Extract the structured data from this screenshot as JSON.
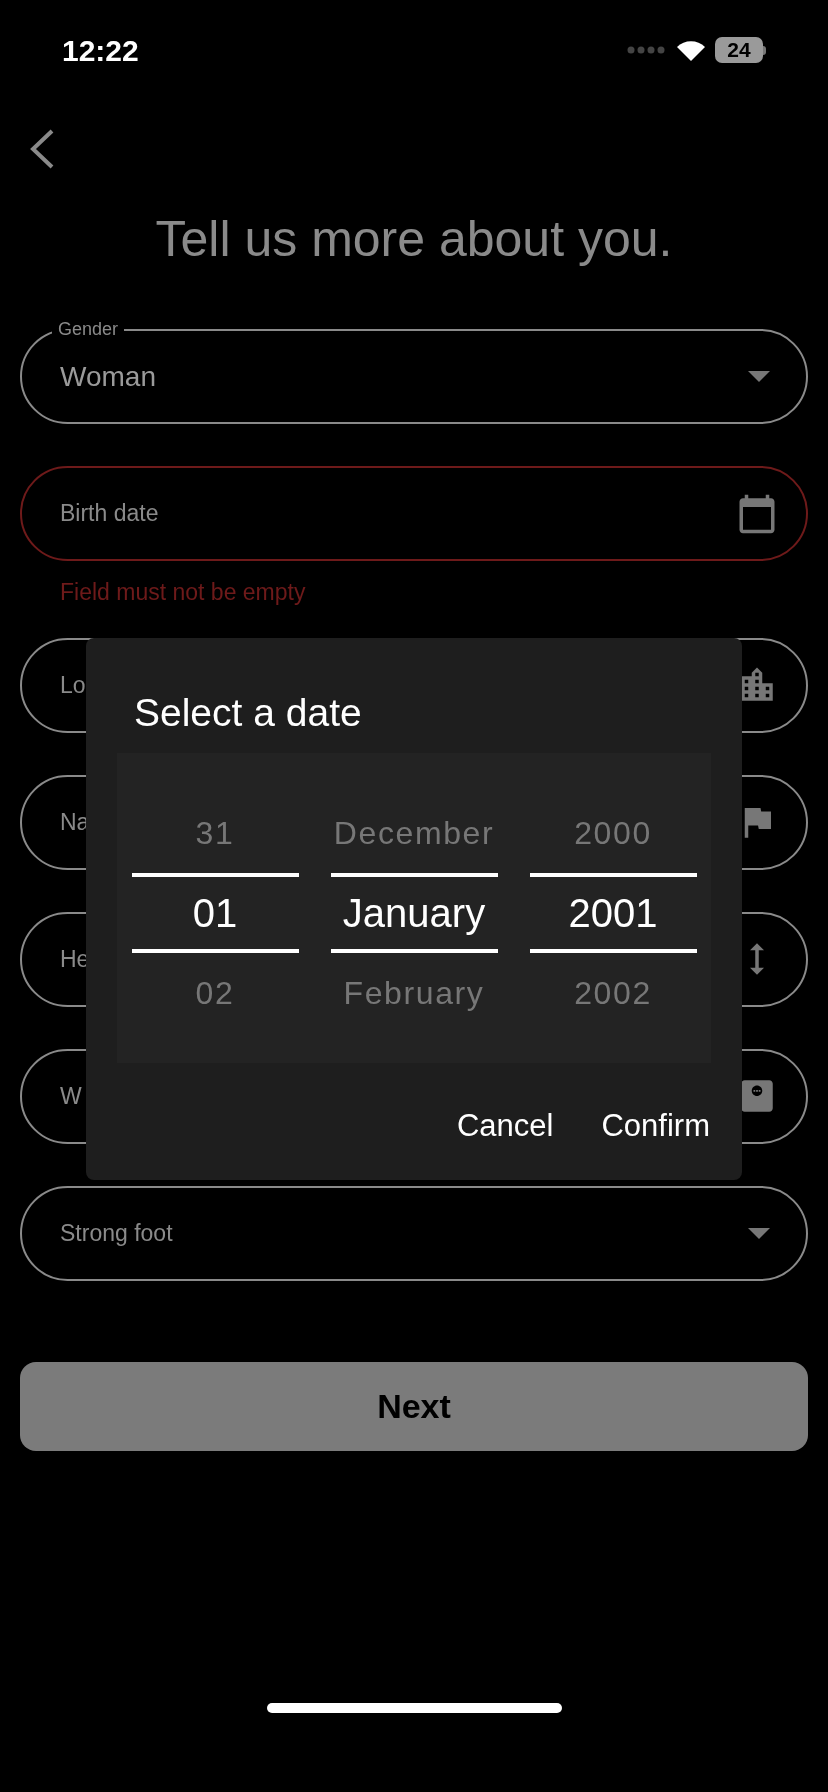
{
  "status_bar": {
    "time": "12:22",
    "battery": "24"
  },
  "title": "Tell us more about you.",
  "fields": [
    {
      "kind": "dropdown",
      "label": "Gender",
      "value": "Woman",
      "error": false
    },
    {
      "kind": "date",
      "placeholder": "Birth date",
      "error": true,
      "error_text": "Field must not be empty"
    },
    {
      "kind": "input",
      "placeholder": "Lo",
      "error": false
    },
    {
      "kind": "input",
      "placeholder": "Na",
      "error": false
    },
    {
      "kind": "input",
      "placeholder": "He",
      "error": false
    },
    {
      "kind": "input",
      "placeholder": "W",
      "error": false
    },
    {
      "kind": "dropdown",
      "placeholder": "Strong foot",
      "error": false
    }
  ],
  "next_button": "Next",
  "dialog": {
    "title": "Select a date",
    "columns": [
      [
        {
          "label": "31",
          "selected": false
        },
        {
          "label": "01",
          "selected": true
        },
        {
          "label": "02",
          "selected": false
        }
      ],
      [
        {
          "label": "December",
          "selected": false
        },
        {
          "label": "January",
          "selected": true
        },
        {
          "label": "February",
          "selected": false
        }
      ],
      [
        {
          "label": "2000",
          "selected": false
        },
        {
          "label": "2001",
          "selected": true
        },
        {
          "label": "2002",
          "selected": false
        }
      ]
    ],
    "buttons": [
      "Cancel",
      "Confirm"
    ]
  }
}
